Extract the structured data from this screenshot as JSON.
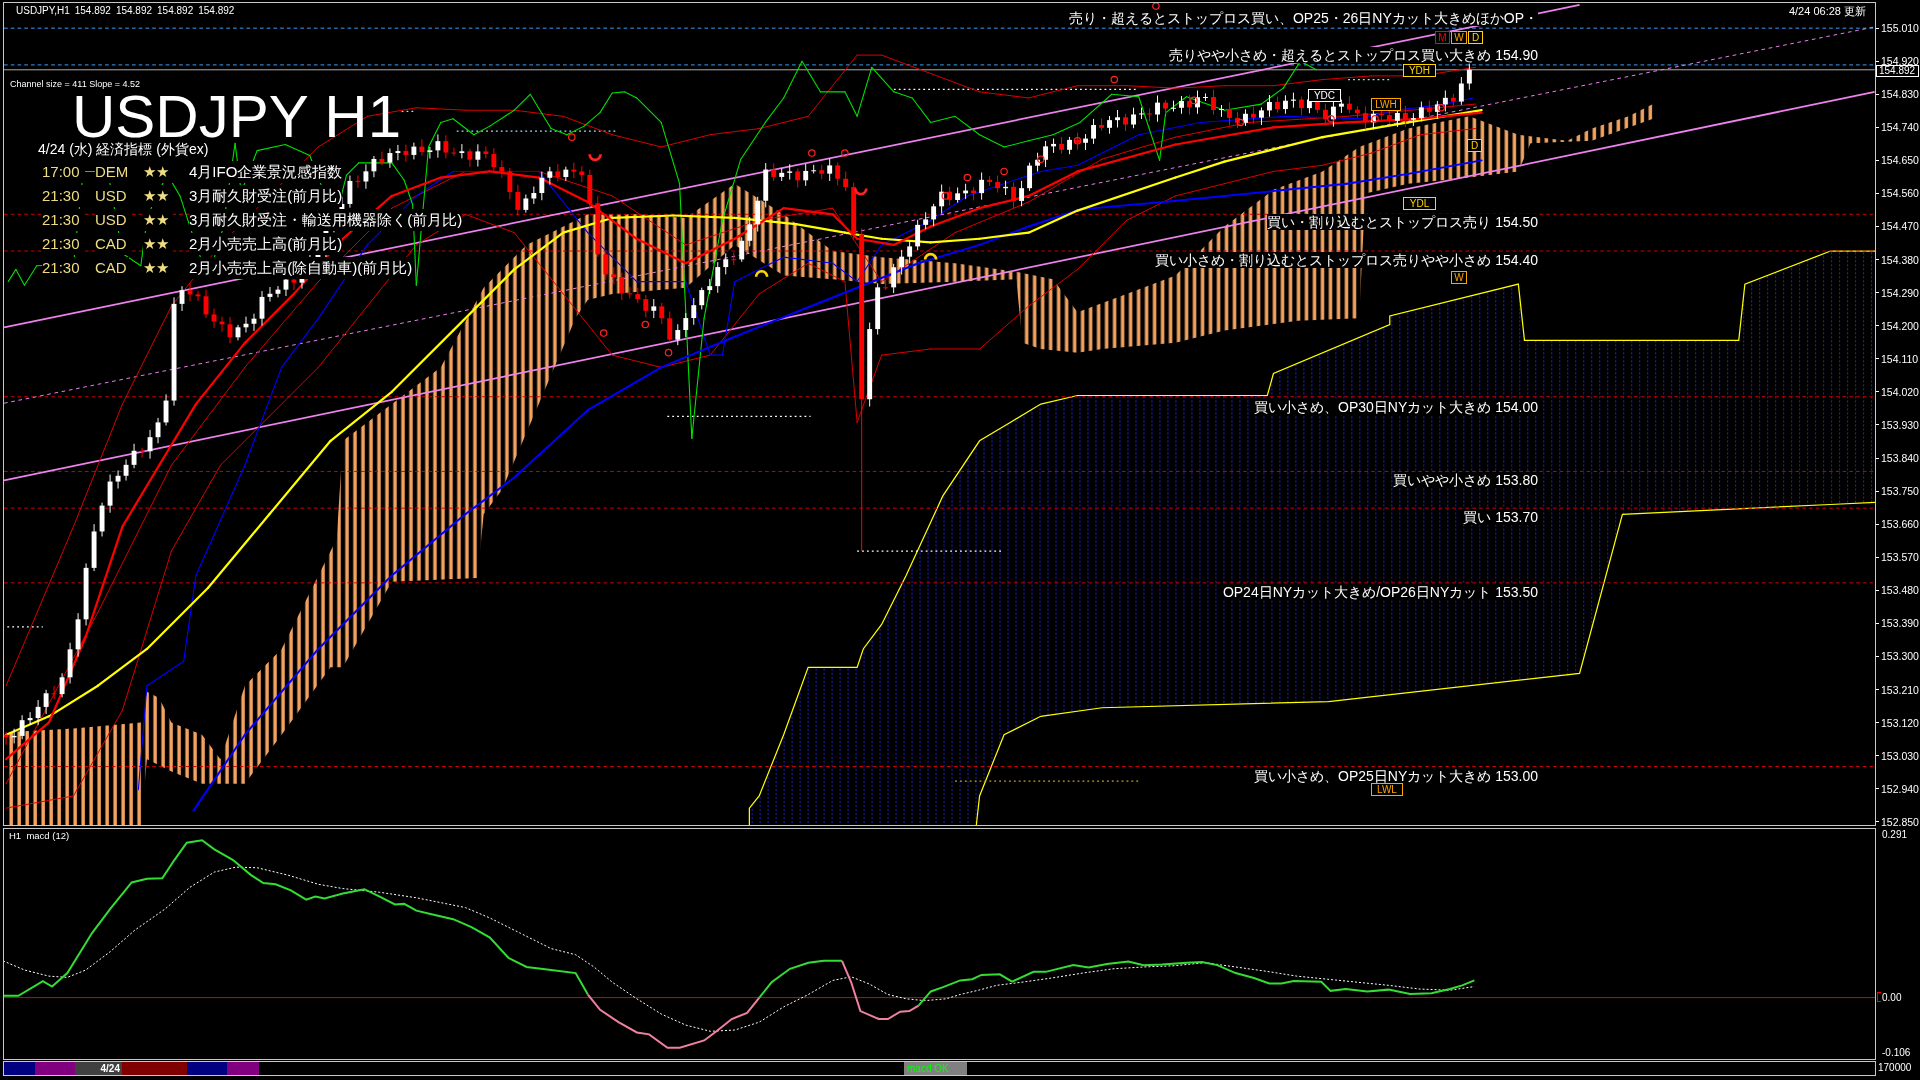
{
  "chart_header": {
    "symbol": "USDJPY,H1",
    "quotes": [
      "154.892",
      "154.892",
      "154.892",
      "154.892"
    ],
    "updated": "4/24 06:28 更新"
  },
  "channel_info": "Channel size = 411 Slope = 4.52",
  "title": "USDJPY H1",
  "calendar": {
    "heading": "4/24 (水) 経済指標 (外貨ex)",
    "events": [
      {
        "time": "17:00",
        "currency": "DEM",
        "importance": "★★",
        "name": "4月IFO企業景況感指数"
      },
      {
        "time": "21:30",
        "currency": "USD",
        "importance": "★★",
        "name": "3月耐久財受注(前月比)"
      },
      {
        "time": "21:30",
        "currency": "USD",
        "importance": "★★",
        "name": "3月耐久財受注・輸送用機器除く(前月比)"
      },
      {
        "time": "21:30",
        "currency": "CAD",
        "importance": "★★",
        "name": "2月小売売上高(前月比)"
      },
      {
        "time": "21:30",
        "currency": "CAD",
        "importance": "★★",
        "name": "2月小売売上高(除自動車)(前月比)"
      }
    ]
  },
  "level_notes": [
    "売り・超えるとストップロス買い、OP25・26日NYカット大きめほかOP・",
    "売りやや小さめ・超えるとストップロス買い大きめ 154.90",
    "買い・割り込むとストップロス売り 154.50",
    "買い小さめ・割り込むとストップロス売りやや小さめ 154.40",
    "買い小さめ、OP30日NYカット大きめ 154.00",
    "買いやや小さめ 153.80",
    "買い 153.70",
    "OP24日NYカット大きめ/OP26日NYカット 153.50",
    "買い小さめ、OP25日NYカット大きめ 153.00"
  ],
  "markers": [
    {
      "label": "M",
      "color": "#ff0000"
    },
    {
      "label": "W",
      "color": "#ffa500"
    },
    {
      "label": "D",
      "color": "#ffd700"
    },
    {
      "label": "YDH",
      "color": "#ffd700"
    },
    {
      "label": "YDC",
      "color": "#ffffff"
    },
    {
      "label": "LWH",
      "color": "#ffa500"
    },
    {
      "label": "D",
      "color": "#ffd700"
    },
    {
      "label": "YDL",
      "color": "#ffd700"
    },
    {
      "label": "W",
      "color": "#ffa500"
    },
    {
      "label": "LWL",
      "color": "#ffa500"
    }
  ],
  "price_axis": {
    "current": "154.892",
    "ticks": [
      "155.010",
      "154.920",
      "154.830",
      "154.740",
      "154.650",
      "154.560",
      "154.470",
      "154.380",
      "154.290",
      "154.200",
      "154.110",
      "154.020",
      "153.930",
      "153.840",
      "153.750",
      "153.660",
      "153.570",
      "153.480",
      "153.390",
      "153.300",
      "153.210",
      "153.120",
      "153.030",
      "152.940",
      "152.850"
    ]
  },
  "macd_pane": {
    "title": "H1  macd (12)",
    "axis": [
      "0.291",
      "0.00",
      "-0.106"
    ]
  },
  "bottom_bar": {
    "segments": [
      {
        "color": "#000080"
      },
      {
        "color": "#800080"
      },
      {
        "label": "4/24",
        "color": "#404040"
      },
      {
        "color": "#800000"
      },
      {
        "color": "#000080"
      },
      {
        "color": "#800080"
      }
    ],
    "status": "macd OK",
    "axis_value": "170000"
  }
}
